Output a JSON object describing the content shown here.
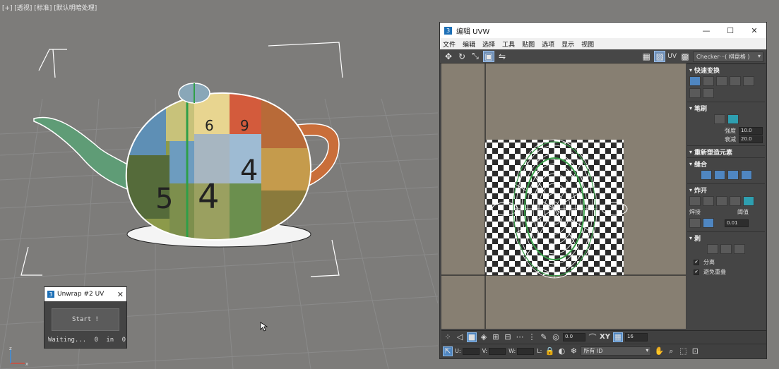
{
  "viewport": {
    "label": "[+] [透视] [标准] [默认明暗处理]"
  },
  "unwrap_window": {
    "title": "Unwrap #2 UV",
    "start_label": "Start !",
    "status_label": "Waiting...",
    "count": "0",
    "in_label": "in",
    "total": "0"
  },
  "uv_editor": {
    "title": "编辑 UVW",
    "menu": [
      "文件",
      "编辑",
      "选择",
      "工具",
      "贴图",
      "选项",
      "显示",
      "视图"
    ],
    "uv_label": "UV",
    "texture_dropdown": "Checker···( 棋盘格 )",
    "sections": {
      "quick_transform": "快速变换",
      "brush": "笔刷",
      "strength_label": "强度",
      "strength_value": "10.0",
      "falloff_label": "衰减",
      "falloff_value": "20.0",
      "reshape": "重新塑造元素",
      "stitch": "缝合",
      "explode": "炸开",
      "weld_label": "焊接",
      "threshold_label": "阈值",
      "threshold_value": "0.01",
      "peel": "剥",
      "detach_label": "分离",
      "avoid_overlap_label": "避免重叠"
    },
    "bottom": {
      "angle_value": "0.0",
      "xy_label": "XY",
      "grid_value": "16",
      "u_label": "U:",
      "v_label": "V:",
      "w_label": "W:",
      "l_label": "L:",
      "all_ids": "所有 ID"
    }
  },
  "colors": {
    "viewport_bg": "#7d7c7a",
    "uv_bg": "#877f72",
    "accent": "#4f86c1",
    "selection_green": "#3aa04a"
  }
}
